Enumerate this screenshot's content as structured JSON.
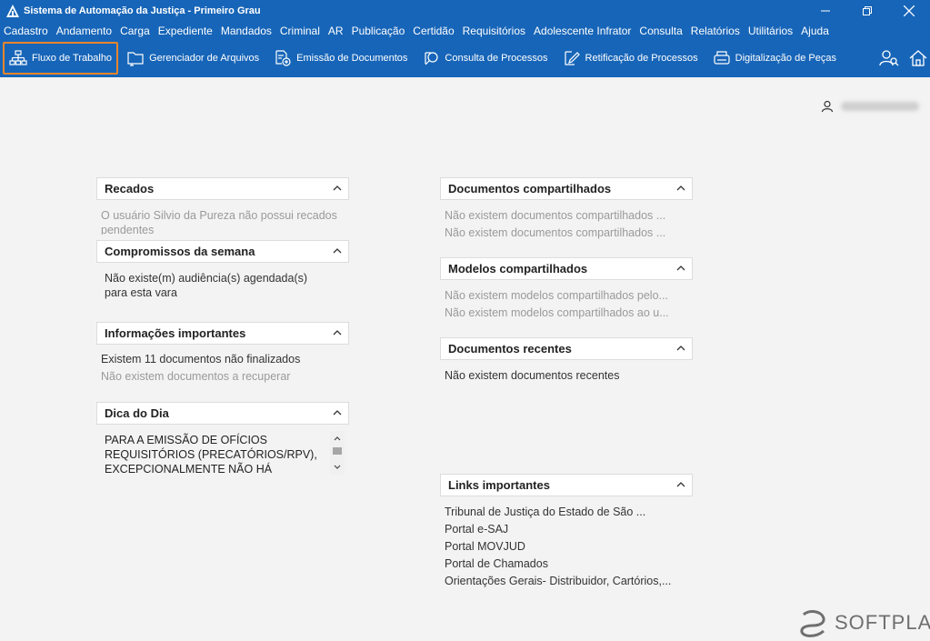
{
  "window": {
    "title": "Sistema de Automação da Justiça - Primeiro Grau"
  },
  "menu": [
    "Cadastro",
    "Andamento",
    "Carga",
    "Expediente",
    "Mandados",
    "Criminal",
    "AR",
    "Publicação",
    "Certidão",
    "Requisitórios",
    "Adolescente Infrator",
    "Consulta",
    "Relatórios",
    "Utilitários",
    "Ajuda"
  ],
  "toolbar": {
    "fluxo": "Fluxo de Trabalho",
    "gerenciador": "Gerenciador de Arquivos",
    "emissao": "Emissão de Documentos",
    "consulta": "Consulta de Processos",
    "retificacao": "Retificação de Processos",
    "digitalizacao": "Digitalização de Peças"
  },
  "panels": {
    "recados": {
      "title": "Recados",
      "text": "O usuário Silvio da Pureza não possui recados pendentes"
    },
    "compromissos": {
      "title": "Compromissos da semana",
      "text": "Não existe(m) audiência(s) agendada(s) para esta vara"
    },
    "informacoes": {
      "title": "Informações importantes",
      "line1": "Existem 11 documentos não finalizados",
      "line2": "Não existem documentos a recuperar"
    },
    "dica": {
      "title": "Dica do Dia",
      "text": "PARA A EMISSÃO DE OFÍCIOS REQUISITÓRIOS (PRECATÓRIOS/RPV), EXCEPCIONALMENTE NÃO HÁ"
    },
    "docs_compartilhados": {
      "title": "Documentos compartilhados",
      "line1": "Não existem documentos compartilhados ...",
      "line2": "Não existem documentos compartilhados ..."
    },
    "modelos": {
      "title": "Modelos compartilhados",
      "line1": "Não existem modelos compartilhados pelo...",
      "line2": "Não existem modelos compartilhados ao u..."
    },
    "recentes": {
      "title": "Documentos recentes",
      "line1": "Não existem documentos recentes"
    },
    "links": {
      "title": "Links importantes",
      "items": [
        "Tribunal de Justiça do Estado de São ...",
        "Portal e-SAJ",
        "Portal MOVJUD",
        "Portal de Chamados",
        "Orientações Gerais- Distribuidor, Cartórios,..."
      ]
    }
  },
  "brand": "SOFTPLAN",
  "colors": {
    "titlebar": "#1765b8",
    "active_outline": "#e8862a",
    "background": "#f3f3f3"
  }
}
